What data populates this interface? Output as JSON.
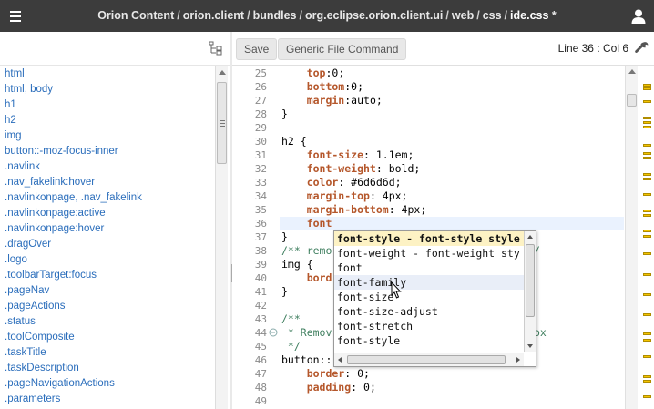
{
  "banner": {
    "breadcrumbs": [
      "Orion Content",
      "orion.client",
      "bundles",
      "org.eclipse.orion.client.ui",
      "web",
      "css"
    ],
    "separator": "/",
    "file_name": "ide.css",
    "dirty_marker": "*"
  },
  "outline": {
    "items": [
      "html",
      "html, body",
      "h1",
      "h2",
      "img",
      "button::-moz-focus-inner",
      ".navlink",
      ".nav_fakelink:hover",
      ".navlinkonpage, .nav_fakelink",
      ".navlinkonpage:active",
      ".navlinkonpage:hover",
      ".dragOver",
      ".logo",
      ".toolbarTarget:focus",
      ".pageNav",
      ".pageActions",
      ".status",
      ".toolComposite",
      ".taskTitle",
      ".taskDescription",
      ".pageNavigationActions",
      ".parameters"
    ]
  },
  "toolbar": {
    "save_label": "Save",
    "generic_label": "Generic File Command",
    "status": "Line 36 : Col 6"
  },
  "editor": {
    "line_numbers": [
      "25",
      "26",
      "27",
      "28",
      "29",
      "30",
      "31",
      "32",
      "33",
      "34",
      "35",
      "36",
      "37",
      "38",
      "39",
      "40",
      "41",
      "42",
      "43",
      "44",
      "45",
      "46",
      "47",
      "48",
      "49"
    ],
    "lines": [
      {
        "prop": "    top",
        "rest": ":0;"
      },
      {
        "prop": "    bottom",
        "rest": ":0;"
      },
      {
        "prop": "    margin",
        "rest": ":auto;"
      },
      {
        "prop": "",
        "rest": "}"
      },
      {
        "prop": "",
        "rest": ""
      },
      {
        "prop": "",
        "rest": "h2 {"
      },
      {
        "prop": "    font-size",
        "rest": ": 1.1em;"
      },
      {
        "prop": "    font-weight",
        "rest": ": bold;"
      },
      {
        "prop": "    color",
        "rest": ": #6d6d6d;"
      },
      {
        "prop": "    margin-top",
        "rest": ": 4px;"
      },
      {
        "prop": "    margin-bottom",
        "rest": ": 4px;"
      },
      {
        "prop": "    font",
        "rest": ""
      },
      {
        "prop": "",
        "rest": "}"
      },
      {
        "prop": "",
        "rest": "",
        "comment": "/** remo                               */"
      },
      {
        "prop": "",
        "rest": "img {"
      },
      {
        "prop": "    bord",
        "rest": ""
      },
      {
        "prop": "",
        "rest": "}"
      },
      {
        "prop": "",
        "rest": ""
      },
      {
        "prop": "",
        "rest": "",
        "comment": "/**"
      },
      {
        "prop": "",
        "rest": "",
        "comment": " * Remov                              efox"
      },
      {
        "prop": "",
        "rest": "",
        "comment": " */"
      },
      {
        "prop": "",
        "rest": "button::-moz-focus-inner {"
      },
      {
        "prop": "    border",
        "rest": ": 0;"
      },
      {
        "prop": "    padding",
        "rest": ": 0;"
      },
      {
        "prop": "",
        "rest": ""
      }
    ],
    "current_line_index": 11
  },
  "assist": {
    "items": [
      "font-style - font-style style",
      "font-weight - font-weight sty",
      "font",
      "font-family",
      "font-size",
      "font-size-adjust",
      "font-stretch",
      "font-style"
    ],
    "selected_index": 0,
    "hover_index": 3
  },
  "colors": {
    "banner_bg": "#3c3c3c",
    "link": "#2a6dbb",
    "property": "#b5572b",
    "comment": "#3f7f5f",
    "annotation": "#f4c400"
  },
  "icons": {
    "menu": "hamburger-icon",
    "user": "user-icon",
    "outline_toggle": "outline-toggle-icon",
    "tools": "wrench-icon"
  }
}
